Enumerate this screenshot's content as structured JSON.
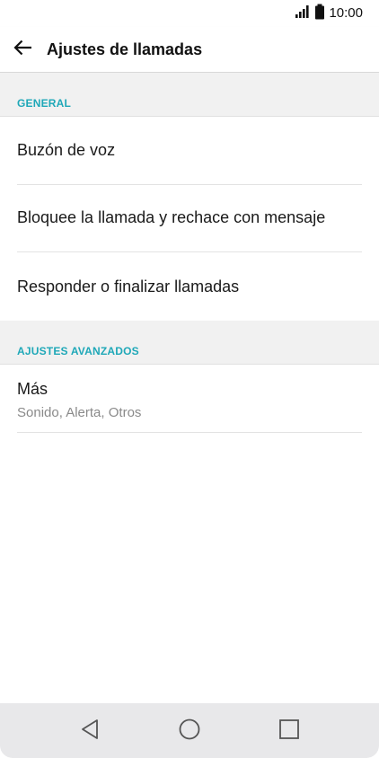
{
  "status_bar": {
    "time": "10:00",
    "icons": [
      "signal-icon",
      "battery-icon"
    ]
  },
  "app_bar": {
    "title": "Ajustes de llamadas",
    "back_icon": "arrow-back-icon"
  },
  "sections": [
    {
      "header": "GENERAL",
      "items": [
        {
          "title": "Buzón de voz"
        },
        {
          "title": "Bloquee la llamada y rechace con mensaje"
        },
        {
          "title": "Responder o finalizar llamadas"
        }
      ]
    },
    {
      "header": "AJUSTES AVANZADOS",
      "items": [
        {
          "title": "Más",
          "subtitle": "Sonido, Alerta, Otros"
        }
      ]
    }
  ],
  "nav_bar": {
    "icons": [
      "back-triangle-icon",
      "home-circle-icon",
      "recents-square-icon"
    ]
  },
  "colors": {
    "accent": "#1fa8b8",
    "section_bg": "#f1f1f1",
    "nav_bg": "#e8e8ea"
  }
}
